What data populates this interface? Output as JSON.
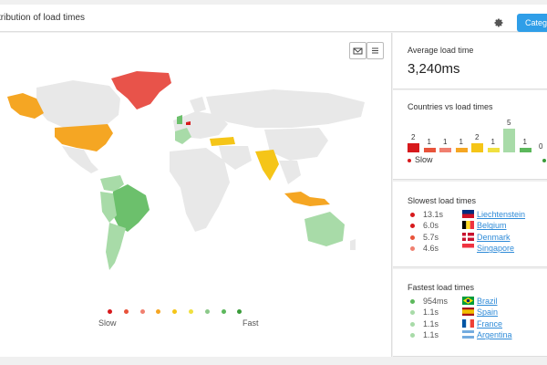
{
  "header": {
    "title": "tribution of load times",
    "category_button": "Catego"
  },
  "map": {
    "legend_slow": "Slow",
    "legend_fast": "Fast",
    "legend_colors": [
      "#d7191c",
      "#e8533a",
      "#f08070",
      "#f5a623",
      "#f5c518",
      "#f0e040",
      "#8cc98a",
      "#5cb85c",
      "#3a9b3a"
    ],
    "region_colors": {
      "slowest": "#e8534a",
      "slow": "#f5a623",
      "mid": "#f5c518",
      "fast_light": "#a8dba8",
      "fast": "#6cc06c",
      "none": "#e8e8e8"
    }
  },
  "average": {
    "heading": "Average load time",
    "value": "3,240ms"
  },
  "countries_vs": {
    "heading": "Countries vs load times",
    "bars": [
      "2",
      "1",
      "1",
      "1",
      "2",
      "1",
      "5",
      "1",
      "0"
    ],
    "bar_colors": [
      "#d7191c",
      "#e8533a",
      "#f08070",
      "#f5a623",
      "#f5c518",
      "#f0e040",
      "#a8dba8",
      "#5cb85c",
      "#3a9b3a"
    ],
    "slow_label": "Slow"
  },
  "slowest": {
    "heading": "Slowest load times",
    "items": [
      {
        "time": "13.1s",
        "country": "Liechtenstein",
        "color": "#d7191c"
      },
      {
        "time": "6.0s",
        "country": "Belgium",
        "color": "#d7191c"
      },
      {
        "time": "5.7s",
        "country": "Denmark",
        "color": "#e8533a"
      },
      {
        "time": "4.6s",
        "country": "Singapore",
        "color": "#f08070"
      }
    ]
  },
  "fastest": {
    "heading": "Fastest load times",
    "items": [
      {
        "time": "954ms",
        "country": "Brazil",
        "color": "#5cb85c"
      },
      {
        "time": "1.1s",
        "country": "Spain",
        "color": "#a8dba8"
      },
      {
        "time": "1.1s",
        "country": "France",
        "color": "#a8dba8"
      },
      {
        "time": "1.1s",
        "country": "Argentina",
        "color": "#a8dba8"
      }
    ]
  }
}
